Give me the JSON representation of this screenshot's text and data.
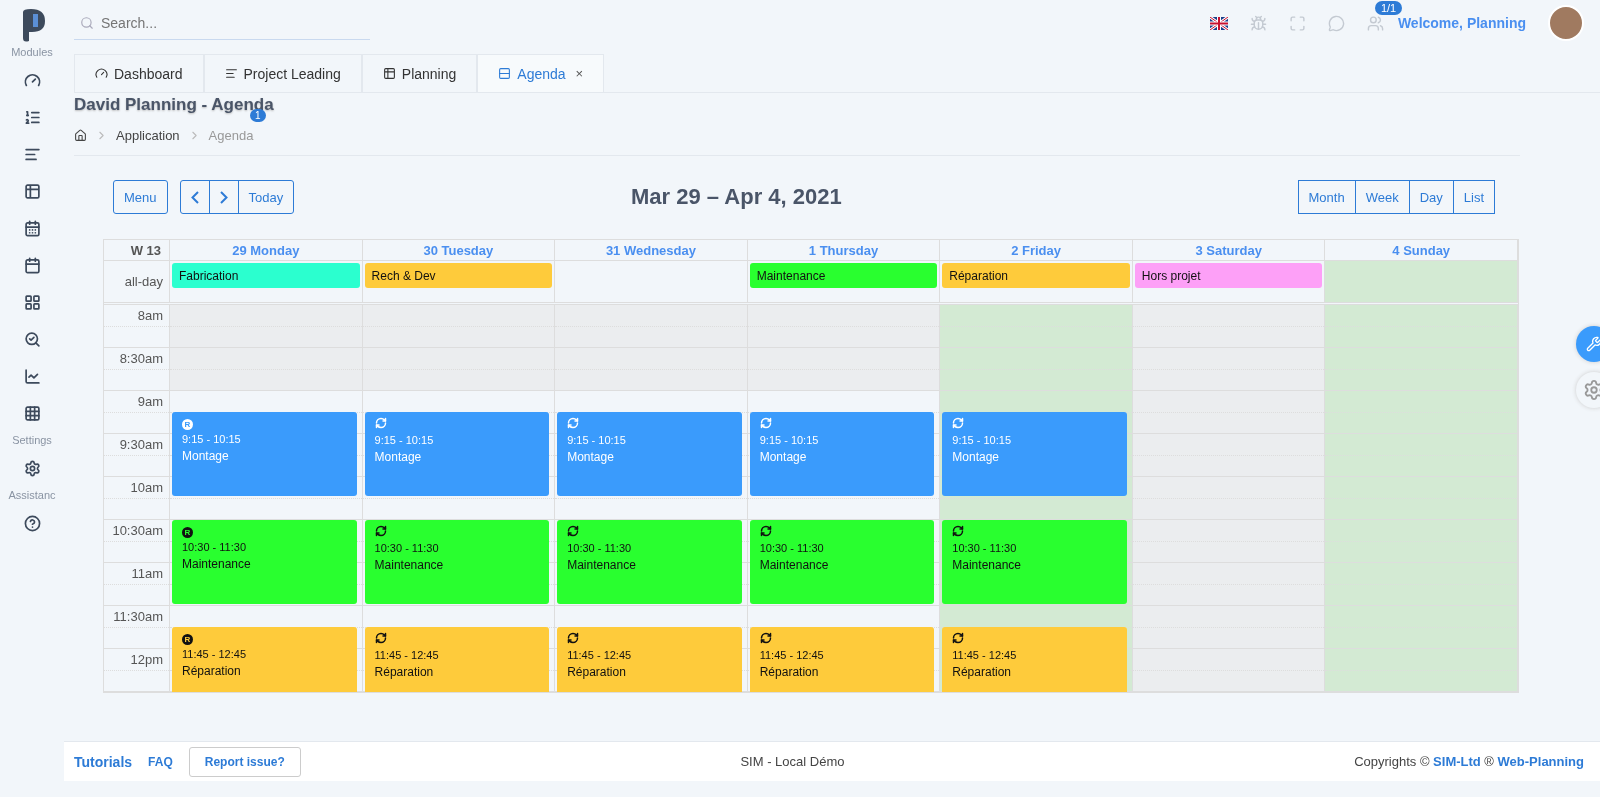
{
  "search": {
    "placeholder": "Search..."
  },
  "topbar": {
    "online_badge": "1/1",
    "welcome": "Welcome, Planning"
  },
  "sidebar": {
    "sections": [
      {
        "label": "Modules"
      },
      {
        "label": "Settings"
      },
      {
        "label": "Assistanc"
      }
    ]
  },
  "tabs": [
    {
      "label": "Dashboard",
      "selected": false
    },
    {
      "label": "Project Leading",
      "selected": false
    },
    {
      "label": "Planning",
      "selected": false
    },
    {
      "label": "Agenda",
      "selected": true,
      "close": "×"
    }
  ],
  "page": {
    "title": "David Planning - Agenda",
    "badge": "1",
    "breadcrumb": [
      "Application",
      "Agenda"
    ]
  },
  "toolbar": {
    "menu": "Menu",
    "today": "Today",
    "range": "Mar 29 – Apr 4, 2021",
    "views": [
      {
        "label": "Month",
        "selected": false
      },
      {
        "label": "Week",
        "selected": false
      },
      {
        "label": "Day",
        "selected": false
      },
      {
        "label": "List",
        "selected": false
      }
    ]
  },
  "calendar": {
    "week": "W 13",
    "allday_label": "all-day",
    "time_labels": [
      "8am",
      "8:30am",
      "9am",
      "9:30am",
      "10am",
      "10:30am",
      "11am",
      "11:30am",
      "12pm"
    ],
    "days": [
      {
        "label": "29 Monday",
        "kind": "workday",
        "allday": {
          "title": "Fabrication",
          "color": "#2bffcf"
        },
        "events": [
          {
            "recurring": false,
            "letter": "R",
            "time": "9:15 - 10:15",
            "title": "Montage",
            "color": "#3a9bfc"
          },
          {
            "recurring": false,
            "letter": "R",
            "time": "10:30 - 11:30",
            "title": "Maintenance",
            "color": "#29ff2f"
          },
          {
            "recurring": false,
            "letter": "R",
            "time": "11:45 - 12:45",
            "title": "Réparation",
            "color": "#fecb3b"
          }
        ]
      },
      {
        "label": "30 Tuesday",
        "kind": "workday",
        "allday": {
          "title": "Rech & Dev",
          "color": "#fecb3b"
        },
        "events": [
          {
            "recurring": true,
            "time": "9:15 - 10:15",
            "title": "Montage",
            "color": "#3a9bfc"
          },
          {
            "recurring": true,
            "time": "10:30 - 11:30",
            "title": "Maintenance",
            "color": "#29ff2f"
          },
          {
            "recurring": true,
            "time": "11:45 - 12:45",
            "title": "Réparation",
            "color": "#fecb3b"
          }
        ]
      },
      {
        "label": "31 Wednesday",
        "kind": "workday",
        "events": [
          {
            "recurring": true,
            "time": "9:15 - 10:15",
            "title": "Montage",
            "color": "#3a9bfc"
          },
          {
            "recurring": true,
            "time": "10:30 - 11:30",
            "title": "Maintenance",
            "color": "#29ff2f"
          },
          {
            "recurring": true,
            "time": "11:45 - 12:45",
            "title": "Réparation",
            "color": "#fecb3b"
          }
        ]
      },
      {
        "label": "1 Thursday",
        "kind": "workday",
        "allday": {
          "title": "Maintenance",
          "color": "#29ff2f"
        },
        "events": [
          {
            "recurring": true,
            "time": "9:15 - 10:15",
            "title": "Montage",
            "color": "#3a9bfc"
          },
          {
            "recurring": true,
            "time": "10:30 - 11:30",
            "title": "Maintenance",
            "color": "#29ff2f"
          },
          {
            "recurring": true,
            "time": "11:45 - 12:45",
            "title": "Réparation",
            "color": "#fecb3b"
          }
        ]
      },
      {
        "label": "2 Friday",
        "kind": "holiday",
        "allday": {
          "title": "Réparation",
          "color": "#fecb3b"
        },
        "events": [
          {
            "recurring": true,
            "time": "9:15 - 10:15",
            "title": "Montage",
            "color": "#3a9bfc"
          },
          {
            "recurring": true,
            "time": "10:30 - 11:30",
            "title": "Maintenance",
            "color": "#29ff2f"
          },
          {
            "recurring": true,
            "time": "11:45 - 12:45",
            "title": "Réparation",
            "color": "#fecb3b"
          }
        ]
      },
      {
        "label": "3 Saturday",
        "kind": "weekend",
        "allday": {
          "title": "Hors projet",
          "color": "#fda0f7"
        }
      },
      {
        "label": "4 Sunday",
        "kind": "closed"
      }
    ]
  },
  "footer": {
    "links": [
      "Tutorials",
      "FAQ"
    ],
    "report": "Report issue?",
    "center": "SIM - Local Démo",
    "copyright": "Copyrights © **SIM-Ltd** ® **Web-Planning**"
  }
}
